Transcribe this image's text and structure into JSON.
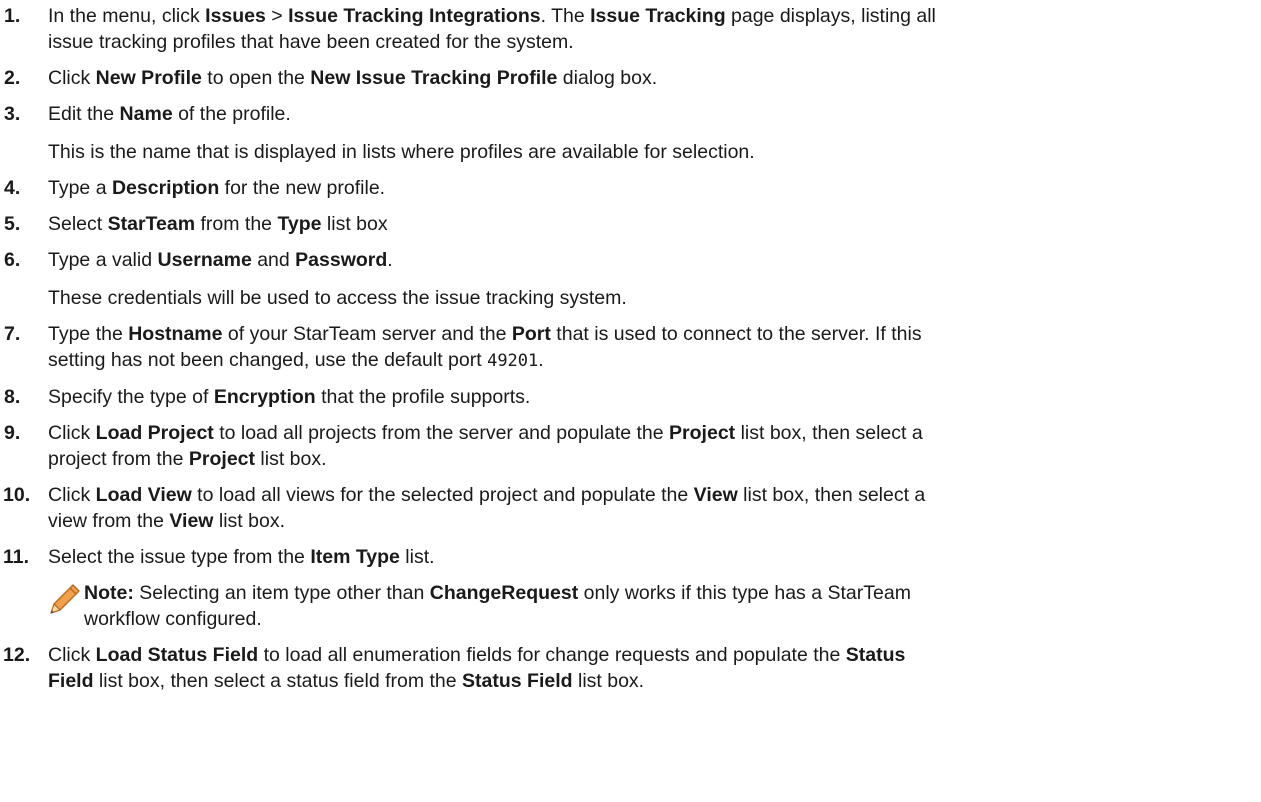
{
  "steps": [
    {
      "num": "1.",
      "lines": [
        [
          {
            "t": "In the menu, click "
          },
          {
            "t": "Issues",
            "b": true
          },
          {
            "t": " > "
          },
          {
            "t": "Issue Tracking Integrations",
            "b": true
          },
          {
            "t": ". The "
          },
          {
            "t": "Issue Tracking",
            "b": true
          },
          {
            "t": " page displays, listing all"
          }
        ],
        [
          {
            "t": "issue tracking profiles that have been created for the system."
          }
        ]
      ]
    },
    {
      "num": "2.",
      "lines": [
        [
          {
            "t": "Click "
          },
          {
            "t": "New Profile",
            "b": true
          },
          {
            "t": " to open the "
          },
          {
            "t": "New Issue Tracking Profile",
            "b": true
          },
          {
            "t": " dialog box."
          }
        ]
      ]
    },
    {
      "num": "3.",
      "lines": [
        [
          {
            "t": "Edit the "
          },
          {
            "t": "Name",
            "b": true
          },
          {
            "t": " of the profile."
          }
        ]
      ],
      "info": "This is the name that is displayed in lists where profiles are available for selection."
    },
    {
      "num": "4.",
      "lines": [
        [
          {
            "t": "Type a "
          },
          {
            "t": "Description",
            "b": true
          },
          {
            "t": " for the new profile."
          }
        ]
      ]
    },
    {
      "num": "5.",
      "lines": [
        [
          {
            "t": "Select "
          },
          {
            "t": "StarTeam",
            "b": true
          },
          {
            "t": " from the "
          },
          {
            "t": "Type",
            "b": true
          },
          {
            "t": " list box"
          }
        ]
      ]
    },
    {
      "num": "6.",
      "lines": [
        [
          {
            "t": "Type a valid "
          },
          {
            "t": "Username",
            "b": true
          },
          {
            "t": " and "
          },
          {
            "t": "Password",
            "b": true
          },
          {
            "t": "."
          }
        ]
      ],
      "info": "These credentials will be used to access the issue tracking system."
    },
    {
      "num": "7.",
      "lines": [
        [
          {
            "t": "Type the "
          },
          {
            "t": "Hostname",
            "b": true
          },
          {
            "t": " of your StarTeam server and the "
          },
          {
            "t": "Port",
            "b": true
          },
          {
            "t": " that is used to connect to the server. If this"
          }
        ],
        [
          {
            "t": "setting has not been changed, use the default port "
          },
          {
            "t": "49201",
            "code": true
          },
          {
            "t": "."
          }
        ]
      ]
    },
    {
      "num": "8.",
      "lines": [
        [
          {
            "t": "Specify the type of "
          },
          {
            "t": "Encryption",
            "b": true
          },
          {
            "t": " that the profile supports."
          }
        ]
      ]
    },
    {
      "num": "9.",
      "lines": [
        [
          {
            "t": "Click "
          },
          {
            "t": "Load Project",
            "b": true
          },
          {
            "t": " to load all projects from the server and populate the "
          },
          {
            "t": "Project",
            "b": true
          },
          {
            "t": " list box, then select a"
          }
        ],
        [
          {
            "t": "project from the "
          },
          {
            "t": "Project",
            "b": true
          },
          {
            "t": " list box."
          }
        ]
      ]
    },
    {
      "num": "10.",
      "lines": [
        [
          {
            "t": "Click "
          },
          {
            "t": "Load View",
            "b": true
          },
          {
            "t": " to load all views for the selected project and populate the "
          },
          {
            "t": "View",
            "b": true
          },
          {
            "t": " list box, then select a"
          }
        ],
        [
          {
            "t": "view from the "
          },
          {
            "t": "View",
            "b": true
          },
          {
            "t": " list box."
          }
        ]
      ]
    },
    {
      "num": "11.",
      "lines": [
        [
          {
            "t": "Select the issue type from the "
          },
          {
            "t": "Item Type",
            "b": true
          },
          {
            "t": " list."
          }
        ]
      ],
      "note": [
        [
          {
            "t": "Note:",
            "b": true
          },
          {
            "t": " Selecting an item type other than "
          },
          {
            "t": "ChangeRequest",
            "b": true
          },
          {
            "t": " only works if this type has a StarTeam"
          }
        ],
        [
          {
            "t": "workflow configured."
          }
        ]
      ]
    },
    {
      "num": "12.",
      "lines": [
        [
          {
            "t": "Click "
          },
          {
            "t": "Load Status Field",
            "b": true
          },
          {
            "t": " to load all enumeration fields for change requests and populate the "
          },
          {
            "t": "Status",
            "b": true
          }
        ],
        [
          {
            "t": "Field",
            "b": true
          },
          {
            "t": " list box, then select a status field from the "
          },
          {
            "t": "Status Field",
            "b": true
          },
          {
            "t": " list box."
          }
        ]
      ]
    }
  ],
  "note_icon": "pencil-note-icon",
  "colors": {
    "text": "#1a1a1a",
    "pencil_orange": "#f2a04a",
    "pencil_outline": "#b86a1c"
  }
}
